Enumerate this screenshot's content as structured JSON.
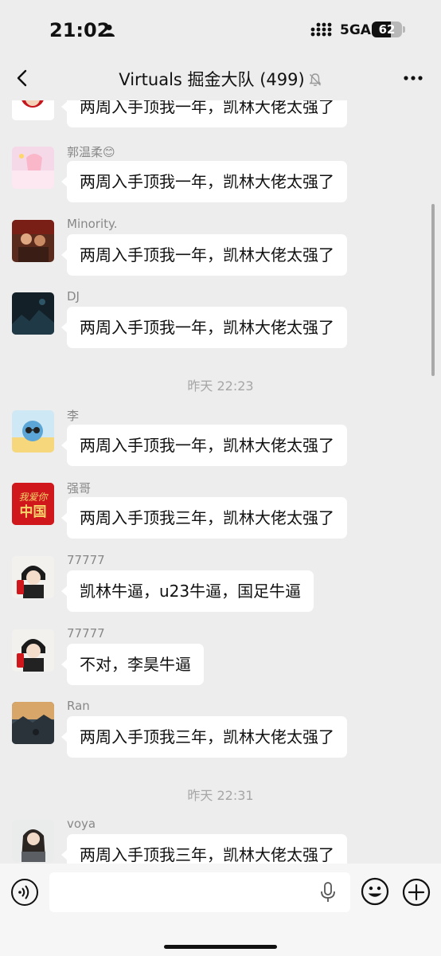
{
  "status_bar": {
    "time": "21:02",
    "network": "5GA",
    "battery": "62",
    "battery_level": 0.62
  },
  "header": {
    "title": "Virtuals 掘金大队 (499)"
  },
  "messages": [
    {
      "sender": "",
      "text": "两周入手顶我一年，凯林大佬太强了"
    },
    {
      "sender": "郭温柔😊",
      "text": "两周入手顶我一年，凯林大佬太强了"
    },
    {
      "sender": "Minority.",
      "text": "两周入手顶我一年，凯林大佬太强了"
    },
    {
      "sender": "DJ",
      "text": "两周入手顶我一年，凯林大佬太强了"
    },
    {
      "sender": "李",
      "text": "两周入手顶我一年，凯林大佬太强了"
    },
    {
      "sender": "强哥",
      "text": "两周入手顶我三年，凯林大佬太强了"
    },
    {
      "sender": "77777",
      "text": "凯林牛逼，u23牛逼，国足牛逼"
    },
    {
      "sender": "77777",
      "text": "不对，李昊牛逼"
    },
    {
      "sender": "Ran",
      "text": "两周入手顶我三年，凯林大佬太强了"
    },
    {
      "sender": "voya",
      "text": "两周入手顶我三年，凯林大佬太强了"
    }
  ],
  "timestamps": [
    "昨天 22:23",
    "昨天 22:31"
  ],
  "avatars": {
    "strong_brother_text": "我爱你中国"
  },
  "icons": [
    "person-icon",
    "signal-icon",
    "back-icon",
    "bell-muted-icon",
    "more-icon",
    "voice-icon",
    "mic-icon",
    "emoji-icon",
    "plus-icon"
  ],
  "colors": {
    "background": "#ededed",
    "bubble": "#ffffff",
    "timestamp": "#a6a6a6",
    "sender": "#888888"
  }
}
